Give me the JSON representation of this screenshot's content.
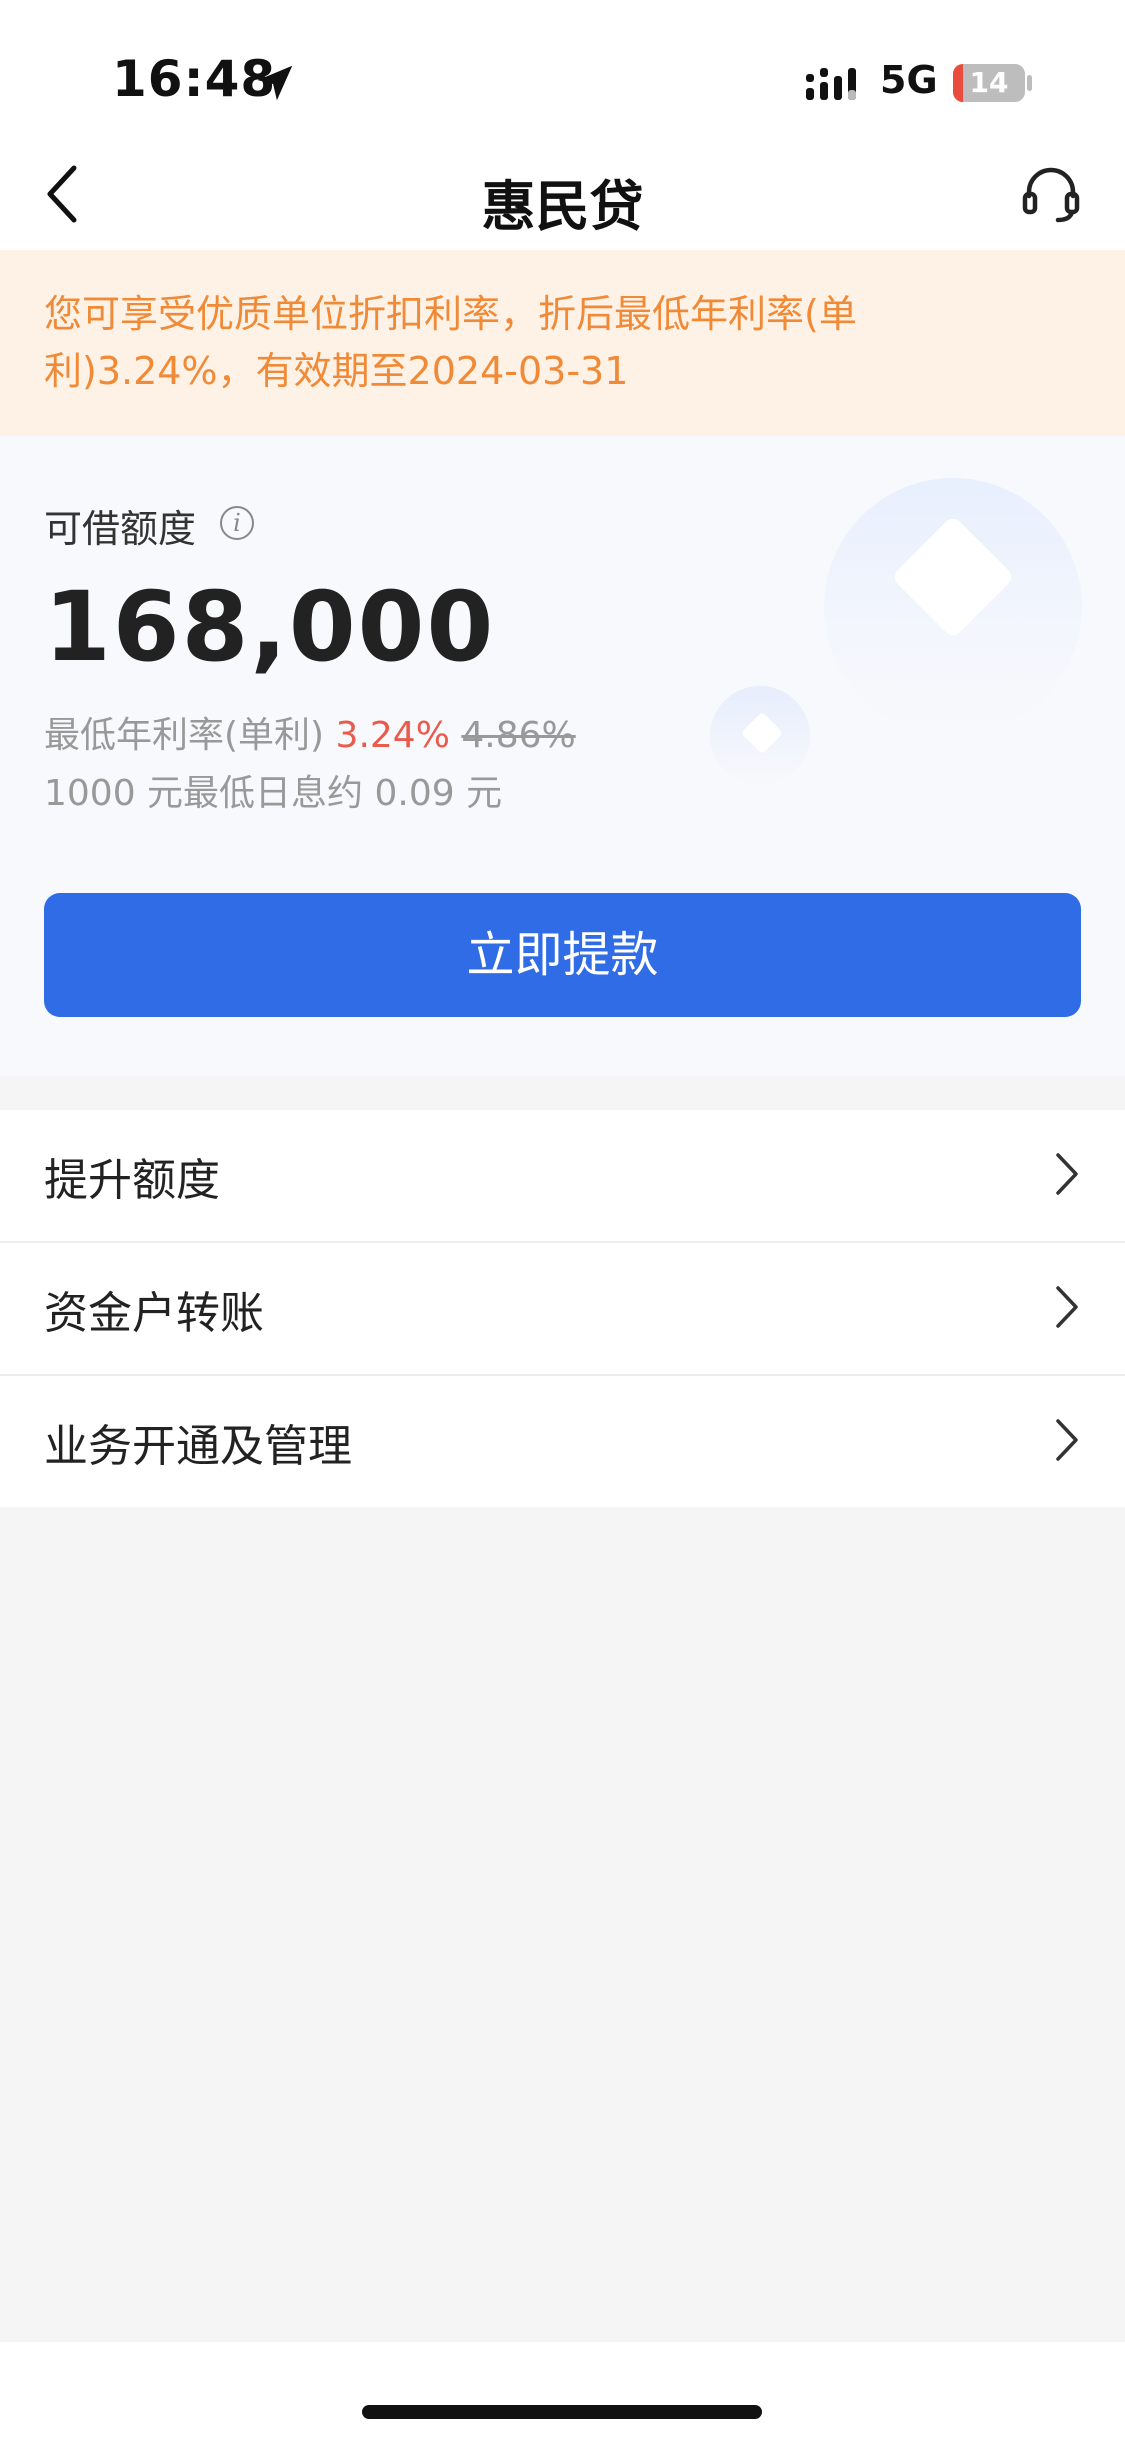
{
  "status_bar": {
    "time": "16:48",
    "network": "5G",
    "battery": "14",
    "battery_level": 0.14
  },
  "header": {
    "title": "惠民贷"
  },
  "notice": {
    "text": "您可享受优质单位折扣利率，折后最低年利率(单利)3.24%，有效期至2024-03-31"
  },
  "credit": {
    "label": "可借额度",
    "info_symbol": "i",
    "amount": "168,000",
    "rate_label": "最低年利率(单利)",
    "rate_discounted": "3.24%",
    "rate_original": "4.86%",
    "daily_interest": "1000 元最低日息约 0.09 元"
  },
  "cta": {
    "label": "立即提款"
  },
  "menu": {
    "items": [
      {
        "label": "提升额度"
      },
      {
        "label": "资金户转账"
      },
      {
        "label": "业务开通及管理"
      }
    ]
  },
  "colors": {
    "primary": "#2f6ce5",
    "notice_bg": "#fef1e6",
    "notice_text": "#f08a36",
    "rate_red": "#e95b4d"
  }
}
